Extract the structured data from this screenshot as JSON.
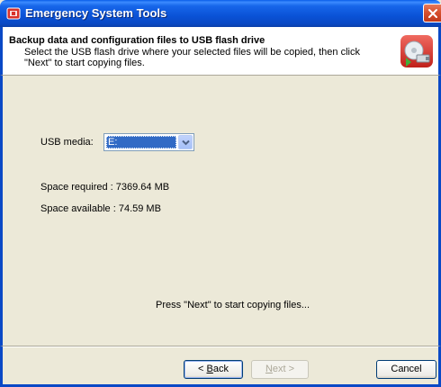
{
  "window": {
    "title": "Emergency System Tools"
  },
  "header": {
    "title": "Backup data and configuration files to USB flash drive",
    "description": "Select the USB flash drive where your selected files will be copied, then click \"Next\" to start copying files."
  },
  "form": {
    "usb_label": "USB media:",
    "usb_value": "E:",
    "space_required": "Space required :   7369.64 MB",
    "space_available": "Space available :  74.59 MB",
    "status_message": "Press \"Next\" to start copying files..."
  },
  "buttons": {
    "back_prefix": "< ",
    "back_key": "B",
    "back_rest": "ack",
    "next_key": "N",
    "next_rest": "ext >",
    "cancel": "Cancel"
  },
  "colors": {
    "titlebar": "#0a52d6",
    "selection": "#316ac5",
    "dialog_bg": "#ece9d8",
    "close_button": "#d7512f"
  },
  "icons": {
    "app": "app-icon",
    "close": "close-icon",
    "header": "usb-backup-icon",
    "dropdown": "chevron-down-icon"
  }
}
